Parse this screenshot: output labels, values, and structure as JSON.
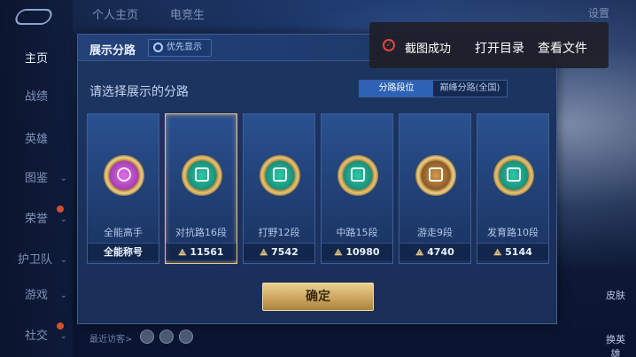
{
  "nav": {
    "items": [
      {
        "label": "主页",
        "active": true
      },
      {
        "label": "战绩"
      },
      {
        "label": "英雄"
      },
      {
        "label": "图鉴",
        "chevron": "⌄"
      },
      {
        "label": "荣誉",
        "chevron": "⌄"
      },
      {
        "label": "护卫队",
        "chevron": "⌄"
      },
      {
        "label": "游戏",
        "chevron": "⌄"
      },
      {
        "label": "社交",
        "chevron": "⌄"
      }
    ]
  },
  "top_tabs": [
    "个人主页",
    "电竞生"
  ],
  "top_right": {
    "settings_label": "设置"
  },
  "dialog": {
    "title": "展示分路",
    "priority_label": "优先显示",
    "subtitle": "请选择展示的分路",
    "toggle": [
      {
        "label": "分路段位",
        "on": true
      },
      {
        "label": "巅峰分路(全国)",
        "on": false
      }
    ],
    "cards": [
      {
        "name": "全能高手",
        "score": "全能称号",
        "badge": "purple",
        "selected": false,
        "show_rank_icon": false
      },
      {
        "name": "对抗路16段",
        "score": "11561",
        "badge": "teal",
        "selected": true,
        "show_rank_icon": true
      },
      {
        "name": "打野12段",
        "score": "7542",
        "badge": "teal",
        "selected": false,
        "show_rank_icon": true
      },
      {
        "name": "中路15段",
        "score": "10980",
        "badge": "teal",
        "selected": false,
        "show_rank_icon": true
      },
      {
        "name": "游走9段",
        "score": "4740",
        "badge": "brown",
        "selected": false,
        "show_rank_icon": true
      },
      {
        "name": "发育路10段",
        "score": "5144",
        "badge": "teal",
        "selected": false,
        "show_rank_icon": true
      }
    ],
    "confirm_label": "确定"
  },
  "toast": {
    "message": "截图成功",
    "open_dir": "打开目录",
    "view_file": "查看文件"
  },
  "visitors_label": "最近访客>",
  "side_buttons": [
    "皮肤",
    "换英雄"
  ],
  "colors": {
    "accent_gold": "#e8c784",
    "toggle_on": "#2e62b6",
    "dialog_bg": "#1d3562",
    "toast_icon": "#e0473d"
  }
}
